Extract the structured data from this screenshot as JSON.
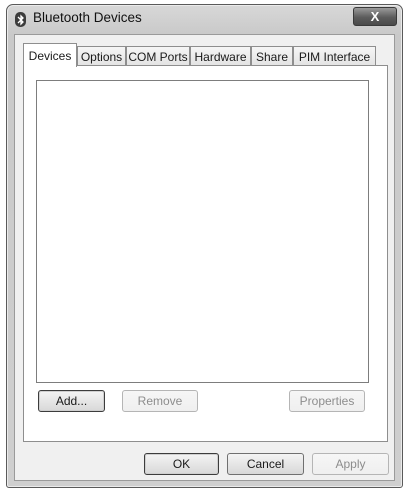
{
  "window": {
    "title": "Bluetooth Devices",
    "close_label": "X"
  },
  "tabs": [
    {
      "label": "Devices",
      "active": true
    },
    {
      "label": "Options",
      "active": false
    },
    {
      "label": "COM Ports",
      "active": false
    },
    {
      "label": "Hardware",
      "active": false
    },
    {
      "label": "Share",
      "active": false
    },
    {
      "label": "PIM Interface",
      "active": false
    }
  ],
  "devices_panel": {
    "device_list": [],
    "add_label": "Add...",
    "remove_label": "Remove",
    "properties_label": "Properties"
  },
  "footer": {
    "ok_label": "OK",
    "cancel_label": "Cancel",
    "apply_label": "Apply"
  }
}
